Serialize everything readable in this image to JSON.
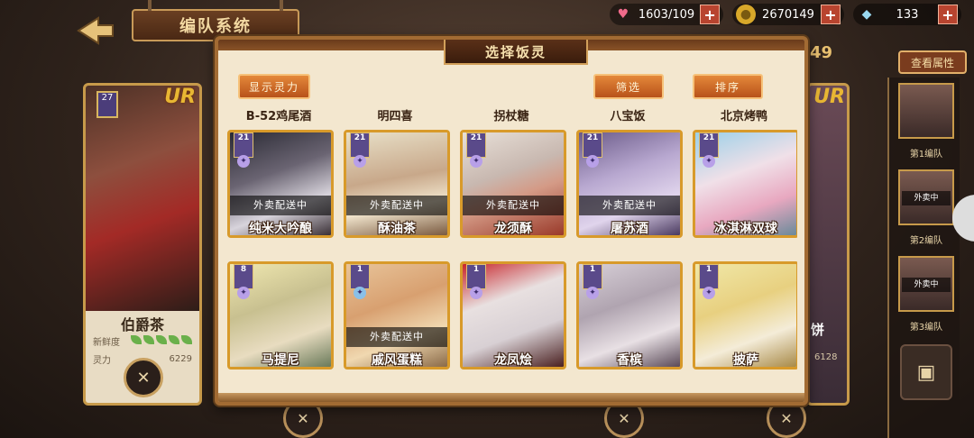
{
  "header": {
    "back_icon": "back-arrow-icon",
    "title": "编队系统"
  },
  "resources": {
    "hearts": {
      "icon": "heart-icon",
      "value": "1603/109",
      "plus": "+"
    },
    "gold": {
      "icon": "gold-coin-icon",
      "value": "2670149",
      "plus": "+"
    },
    "crystal": {
      "icon": "crystal-icon",
      "value": "133",
      "plus": "+"
    }
  },
  "view_attributes_label": "查看属性",
  "left_card": {
    "rarity": "UR",
    "level": "27",
    "name": "伯爵茶",
    "freshness_label": "新鲜度",
    "power_label": "灵力",
    "power_value": "6229",
    "action_icon": "utensils-icon"
  },
  "right_peek": {
    "rarity": "UR",
    "name_partial": "饼",
    "power_partial": "6128",
    "number_partial": "49"
  },
  "team_column": {
    "slots": [
      {
        "label": "第1编队",
        "badge": ""
      },
      {
        "label": "第2编队",
        "badge": "外卖中"
      },
      {
        "label": "第3编队",
        "badge": "外卖中"
      }
    ],
    "chest_icon": "chest-icon"
  },
  "modal": {
    "title": "选择饭灵",
    "show_power_button": "显示灵力",
    "filter_button": "筛选",
    "sort_button": "排序",
    "previous_row_names": [
      "B-52鸡尾酒",
      "明四喜",
      "拐杖糖",
      "八宝饭",
      "北京烤鸭"
    ],
    "delivery_text": "外卖配送中",
    "cells": [
      {
        "name": "纯米大吟酿",
        "level": "21",
        "delivering": true
      },
      {
        "name": "酥油茶",
        "level": "21",
        "delivering": true
      },
      {
        "name": "龙须酥",
        "level": "21",
        "delivering": true
      },
      {
        "name": "屠苏酒",
        "level": "21",
        "delivering": true
      },
      {
        "name": "冰淇淋双球",
        "level": "21",
        "delivering": false
      },
      {
        "name": "马提尼",
        "level": "8",
        "delivering": false
      },
      {
        "name": "戚风蛋糕",
        "level": "1",
        "delivering": true
      },
      {
        "name": "龙凤烩",
        "level": "1",
        "delivering": false
      },
      {
        "name": "香槟",
        "level": "1",
        "delivering": false
      },
      {
        "name": "披萨",
        "level": "1",
        "delivering": false
      }
    ]
  }
}
